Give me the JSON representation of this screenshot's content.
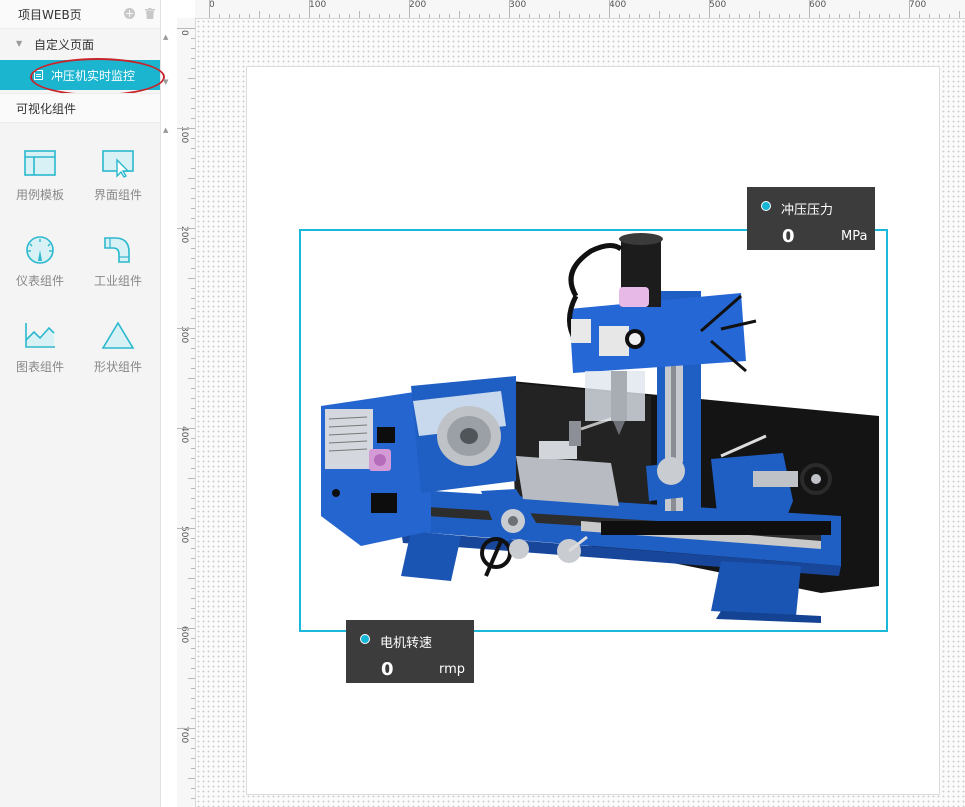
{
  "sidebar": {
    "project_title": "项目WEB页",
    "tree": {
      "parent_label": "自定义页面",
      "selected_page": "冲压机实时监控"
    },
    "components_title": "可视化组件",
    "components": [
      {
        "label": "用例模板",
        "icon": "template-icon"
      },
      {
        "label": "界面组件",
        "icon": "interface-icon"
      },
      {
        "label": "仪表组件",
        "icon": "gauge-icon"
      },
      {
        "label": "工业组件",
        "icon": "pipe-icon"
      },
      {
        "label": "图表组件",
        "icon": "chart-icon"
      },
      {
        "label": "形状组件",
        "icon": "triangle-icon"
      }
    ]
  },
  "rulers": {
    "x_labels": [
      "0",
      "100",
      "200",
      "300",
      "400",
      "500",
      "600",
      "700"
    ],
    "y_labels": [
      "0",
      "100",
      "200",
      "300",
      "400",
      "500",
      "600",
      "700"
    ]
  },
  "cards": {
    "pressure": {
      "title": "冲压压力",
      "value": "0",
      "unit": "MPa"
    },
    "motor": {
      "title": "电机转速",
      "value": "0",
      "unit": "rmp"
    }
  },
  "colors": {
    "accent": "#1bb5d0",
    "frame": "#1ab8d9",
    "card_bg": "#3c3c3c",
    "annotation": "#c7252b",
    "machine_blue": "#1f5fc4"
  }
}
